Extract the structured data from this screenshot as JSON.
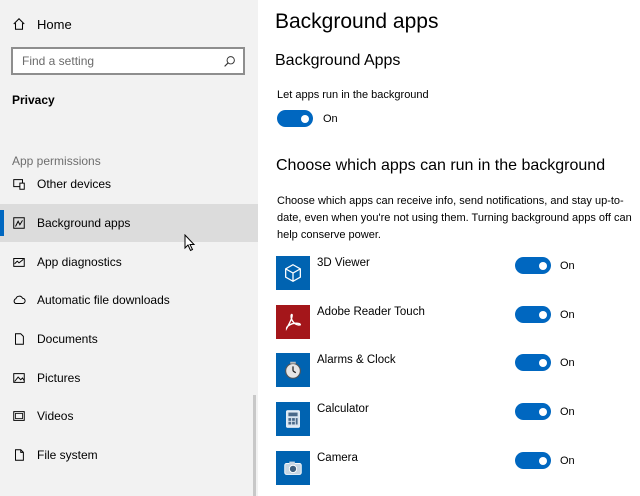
{
  "sidebar": {
    "home_label": "Home",
    "search_placeholder": "Find a setting",
    "section_title": "Privacy",
    "group_label": "App permissions",
    "items": [
      {
        "label": "Other devices",
        "icon": "other-devices-icon"
      },
      {
        "label": "Background apps",
        "icon": "background-apps-icon",
        "selected": true
      },
      {
        "label": "App diagnostics",
        "icon": "app-diagnostics-icon"
      },
      {
        "label": "Automatic file downloads",
        "icon": "cloud-icon"
      },
      {
        "label": "Documents",
        "icon": "document-icon"
      },
      {
        "label": "Pictures",
        "icon": "picture-icon"
      },
      {
        "label": "Videos",
        "icon": "video-icon"
      },
      {
        "label": "File system",
        "icon": "file-icon"
      }
    ]
  },
  "main": {
    "page_title": "Background apps",
    "section_title": "Background Apps",
    "master_toggle": {
      "label": "Let apps run in the background",
      "state": "On",
      "on": true
    },
    "apps_heading": "Choose which apps can run in the background",
    "apps_description": "Choose which apps can receive info, send notifications, and stay up-to-date, even when you're not using them. Turning background apps off can help conserve power.",
    "apps": [
      {
        "name": "3D Viewer",
        "state": "On",
        "on": true,
        "icon": "3d-viewer-icon",
        "color": "#0063b1"
      },
      {
        "name": "Adobe Reader Touch",
        "state": "On",
        "on": true,
        "icon": "adobe-reader-icon",
        "color": "#a4161a"
      },
      {
        "name": "Alarms & Clock",
        "state": "On",
        "on": true,
        "icon": "clock-icon",
        "color": "#0063b1"
      },
      {
        "name": "Calculator",
        "state": "On",
        "on": true,
        "icon": "calculator-icon",
        "color": "#0063b1"
      },
      {
        "name": "Camera",
        "state": "On",
        "on": true,
        "icon": "camera-icon",
        "color": "#0063b1"
      }
    ]
  },
  "colors": {
    "accent": "#0067c0",
    "sidebar_bg": "#f2f2f2",
    "selected_bg": "#dcdcdc"
  }
}
